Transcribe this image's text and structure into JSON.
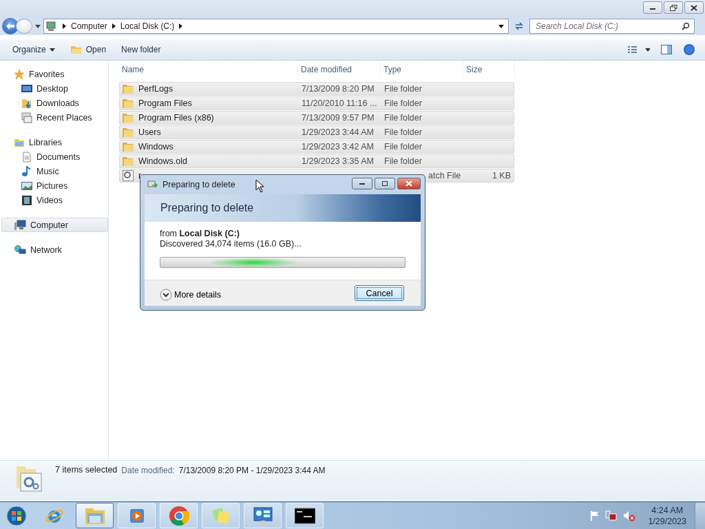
{
  "address": {
    "crumbs": [
      "Computer",
      "Local Disk (C:)"
    ]
  },
  "search": {
    "placeholder": "Search Local Disk (C:)"
  },
  "toolbar": [
    {
      "label": "Organize",
      "kind": "menu"
    },
    {
      "label": "Open",
      "kind": "open"
    },
    {
      "label": "New folder",
      "kind": "plain"
    }
  ],
  "sidebar": [
    {
      "label": "Favorites",
      "kind": "star",
      "selected": false,
      "children": [
        {
          "label": "Desktop",
          "kind": "desktop",
          "selected": false
        },
        {
          "label": "Downloads",
          "kind": "downloads",
          "selected": false
        },
        {
          "label": "Recent Places",
          "kind": "recent",
          "selected": false
        }
      ]
    },
    {
      "label": "Libraries",
      "kind": "libraries",
      "selected": false,
      "children": [
        {
          "label": "Documents",
          "kind": "documents",
          "selected": false
        },
        {
          "label": "Music",
          "kind": "music",
          "selected": false
        },
        {
          "label": "Pictures",
          "kind": "pictures",
          "selected": false
        },
        {
          "label": "Videos",
          "kind": "videos",
          "selected": false
        }
      ]
    },
    {
      "label": "Computer",
      "kind": "computer",
      "selected": true
    },
    {
      "label": "Network",
      "kind": "network",
      "selected": false
    }
  ],
  "table": {
    "columns": [
      "Name",
      "Date modified",
      "Type",
      "Size"
    ],
    "rows": [
      {
        "kind": "folder",
        "name": "PerfLogs",
        "date": "7/13/2009 8:20 PM",
        "type": "File folder",
        "selected": true
      },
      {
        "kind": "folder",
        "name": "Program Files",
        "date": "11/20/2010 11:16 ...",
        "type": "File folder",
        "selected": true
      },
      {
        "kind": "folder",
        "name": "Program Files (x86)",
        "date": "7/13/2009 9:57 PM",
        "type": "File folder",
        "selected": true
      },
      {
        "kind": "folder",
        "name": "Users",
        "date": "1/29/2023 3:44 AM",
        "type": "File folder",
        "selected": true
      },
      {
        "kind": "folder",
        "name": "Windows",
        "date": "1/29/2023 3:42 AM",
        "type": "File folder",
        "selected": true
      },
      {
        "kind": "folder",
        "name": "Windows.old",
        "date": "1/29/2023 3:35 AM",
        "type": "File folder",
        "selected": true
      },
      {
        "kind": "batch",
        "name": "r",
        "type": "atch File",
        "size": "1 KB",
        "selected": true
      }
    ]
  },
  "status": {
    "count": "7 items selected",
    "label": "Date modified:",
    "value": "7/13/2009 8:20 PM - 1/29/2023 3:44 AM"
  },
  "dialog": {
    "title": "Preparing to delete",
    "heading": "Preparing to delete",
    "source": "from **Local Disk (C:)**",
    "progress_text": "Discovered 34,074 items (16.0 GB)...",
    "indeterminate": true,
    "more": "More details",
    "cancel": "Cancel"
  },
  "taskbar": {
    "apps": [
      {
        "kind": "ie",
        "selected": false
      },
      {
        "kind": "explorer",
        "selected": true
      },
      {
        "kind": "media",
        "selected": false
      },
      {
        "kind": "chrome",
        "selected": false
      },
      {
        "kind": "notes",
        "selected": false
      },
      {
        "kind": "panel",
        "selected": false
      },
      {
        "kind": "cmd",
        "selected": false
      }
    ],
    "time": "4:24 AM",
    "date": "1/29/2023"
  }
}
